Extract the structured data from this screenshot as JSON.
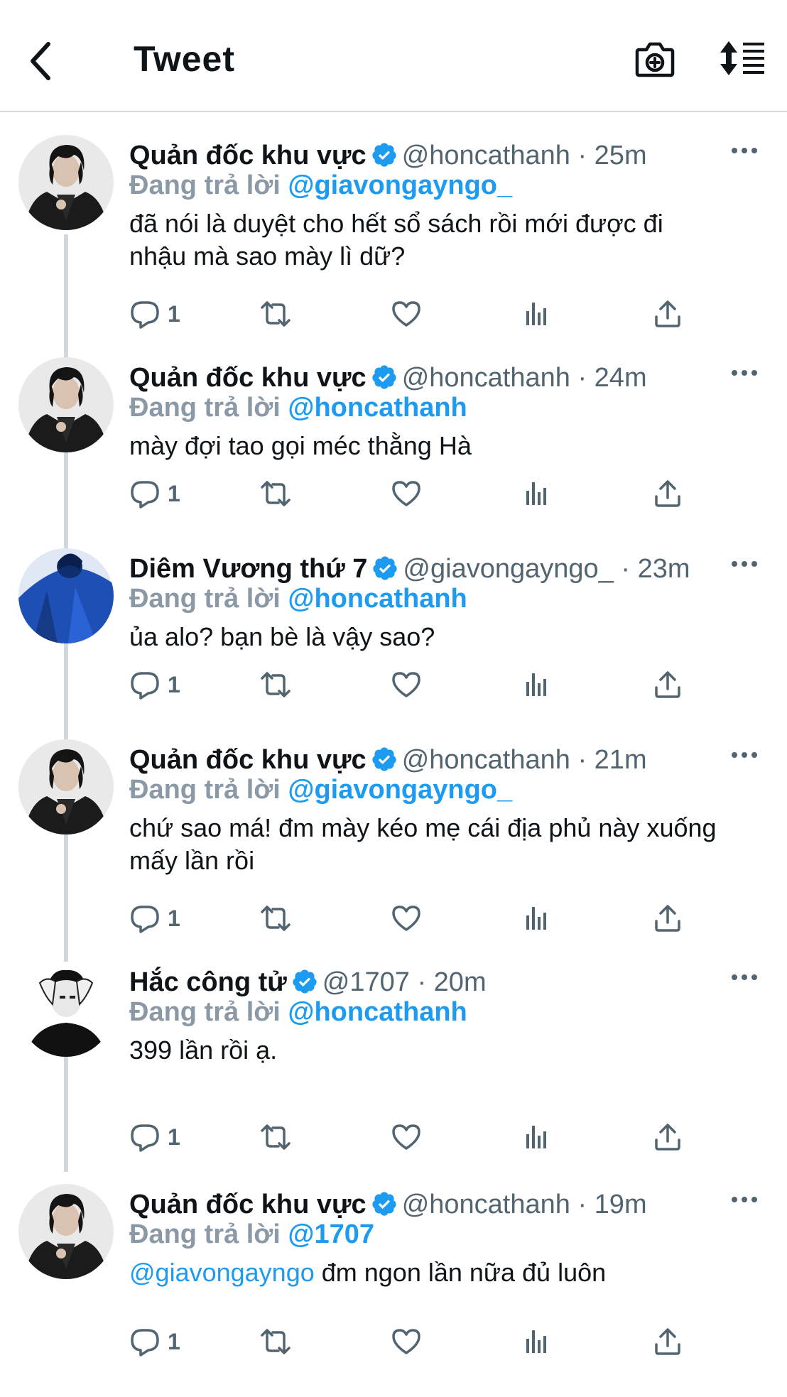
{
  "header": {
    "title": "Tweet"
  },
  "colors": {
    "accent": "#1d9bf0",
    "verified": "#1d9bf0",
    "muted": "#536471"
  },
  "tweets": [
    {
      "display_name": "Quản đốc khu vực",
      "handle": "@honcathanh",
      "time": "25m",
      "reply_label": "Đang trả lời",
      "reply_to": "@giavongayngo_",
      "mention": "",
      "text": "đã nói là duyệt cho hết sổ sách rồi mới được đi nhậu mà sao mày lì dữ?",
      "reply_count": "1",
      "avatar": "man-in-black-jacket"
    },
    {
      "display_name": "Quản đốc khu vực",
      "handle": "@honcathanh",
      "time": "24m",
      "reply_label": "Đang trả lời",
      "reply_to": "@honcathanh",
      "mention": "",
      "text": "mày đợi tao gọi méc thằng Hà",
      "reply_count": "1",
      "avatar": "man-in-black-jacket"
    },
    {
      "display_name": "Diêm Vương thứ 7",
      "handle": "@giavongayngo_",
      "time": "23m",
      "reply_label": "Đang trả lời",
      "reply_to": "@honcathanh",
      "mention": "",
      "text": "ủa alo? bạn bè là vậy sao?",
      "reply_count": "1",
      "avatar": "man-in-blue-jacket"
    },
    {
      "display_name": "Quản đốc khu vực",
      "handle": "@honcathanh",
      "time": "21m",
      "reply_label": "Đang trả lời",
      "reply_to": "@giavongayngo_",
      "mention": "",
      "text": "chứ sao má! đm mày kéo mẹ cái địa phủ này xuống mấy lần rồi",
      "reply_count": "1",
      "avatar": "man-in-black-jacket"
    },
    {
      "display_name": "Hắc công tử",
      "handle": "@1707",
      "time": "20m",
      "reply_label": "Đang trả lời",
      "reply_to": "@honcathanh",
      "mention": "",
      "text": "399 lần rồi ạ.",
      "reply_count": "1",
      "avatar": "man-hands-on-head-bw"
    },
    {
      "display_name": "Quản đốc khu vực",
      "handle": "@honcathanh",
      "time": "19m",
      "reply_label": "Đang trả lời",
      "reply_to": "@1707",
      "mention": "@giavongayngo",
      "text": " đm ngon lần nữa đủ luôn",
      "reply_count": "1",
      "avatar": "man-in-black-jacket"
    }
  ]
}
